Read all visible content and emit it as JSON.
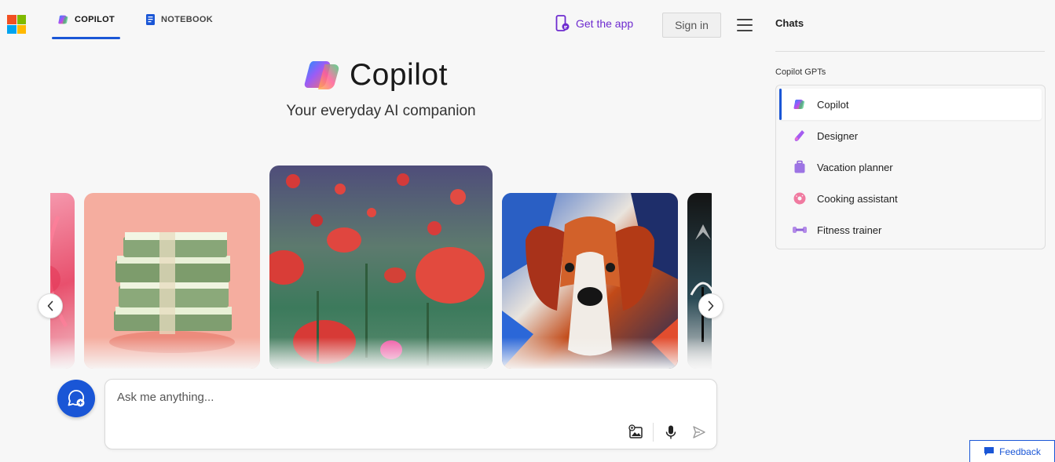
{
  "header": {
    "tabs": [
      {
        "label": "COPILOT",
        "active": true
      },
      {
        "label": "NOTEBOOK",
        "active": false
      }
    ],
    "get_app_label": "Get the app",
    "sign_in_label": "Sign in"
  },
  "hero": {
    "title": "Copilot",
    "subtitle": "Your everyday AI companion"
  },
  "carousel": {
    "cards": [
      {
        "name": "pink-floral-art"
      },
      {
        "name": "money-stacks"
      },
      {
        "name": "red-poppies-field"
      },
      {
        "name": "colorful-dog-painting"
      },
      {
        "name": "tropical-palm-art"
      }
    ]
  },
  "composer": {
    "placeholder": "Ask me anything..."
  },
  "sidebar": {
    "title": "Chats",
    "section_label": "Copilot GPTs",
    "items": [
      {
        "label": "Copilot",
        "icon": "copilot-icon",
        "active": true
      },
      {
        "label": "Designer",
        "icon": "designer-icon",
        "active": false
      },
      {
        "label": "Vacation planner",
        "icon": "suitcase-icon",
        "active": false
      },
      {
        "label": "Cooking assistant",
        "icon": "donut-icon",
        "active": false
      },
      {
        "label": "Fitness trainer",
        "icon": "dumbbell-icon",
        "active": false
      }
    ]
  },
  "feedback_label": "Feedback",
  "colors": {
    "accent": "#1a56d6",
    "get_app": "#6e2bcf"
  }
}
